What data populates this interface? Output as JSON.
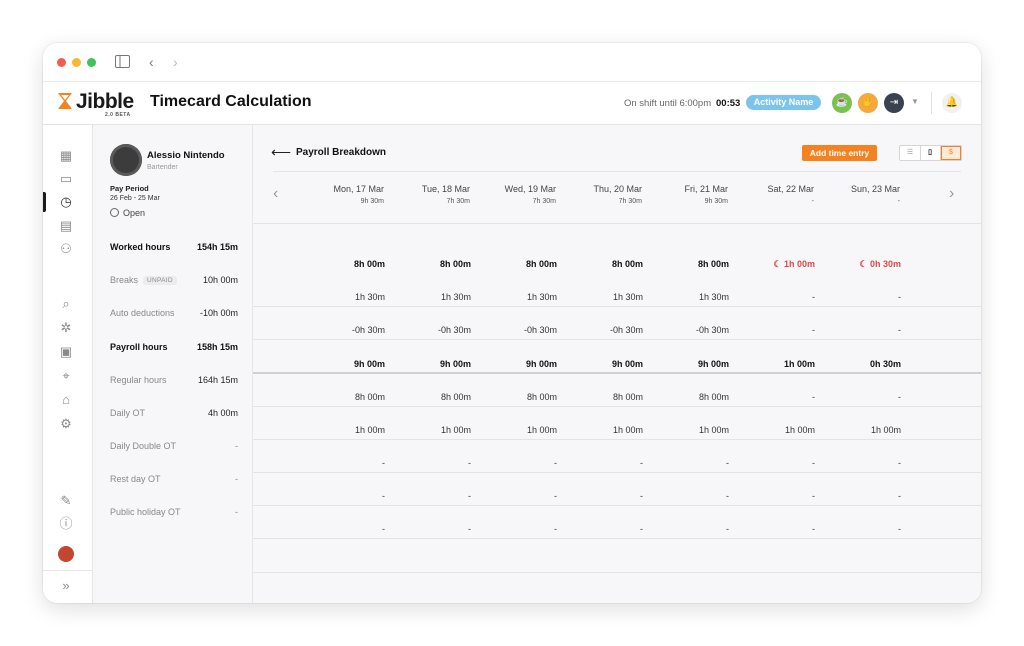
{
  "app": {
    "logo": "Jibble",
    "logo_sub": "2.0 BETA",
    "page_title": "Timecard Calculation"
  },
  "header": {
    "shift_text": "On shift until 6:00pm",
    "timer": "00:53",
    "activity": "Activity Name"
  },
  "employee": {
    "name": "Alessio Nintendo",
    "role": "Bartender",
    "pay_period_label": "Pay Period",
    "pay_period_range": "26 Feb - 25 Mar",
    "status": "Open"
  },
  "breakdown": {
    "title": "Payroll Breakdown",
    "add_button": "Add time entry",
    "days": [
      {
        "name": "Mon, 17 Mar",
        "hours": "9h 30m"
      },
      {
        "name": "Tue, 18 Mar",
        "hours": "7h 30m"
      },
      {
        "name": "Wed, 19 Mar",
        "hours": "7h 30m"
      },
      {
        "name": "Thu, 20 Mar",
        "hours": "7h 30m"
      },
      {
        "name": "Fri, 21 Mar",
        "hours": "9h 30m"
      },
      {
        "name": "Sat, 22 Mar",
        "hours": "-"
      },
      {
        "name": "Sun, 23 Mar",
        "hours": "-"
      }
    ],
    "rows": [
      {
        "label": "Worked hours",
        "total": "154h 15m",
        "cells": [
          "8h 00m",
          "8h 00m",
          "8h 00m",
          "8h 00m",
          "8h 00m",
          "1h 00m",
          "0h 30m"
        ]
      },
      {
        "label": "Breaks",
        "badge": "UNPAID",
        "total": "10h 00m",
        "cells": [
          "1h 30m",
          "1h 30m",
          "1h 30m",
          "1h 30m",
          "1h 30m",
          "-",
          "-"
        ]
      },
      {
        "label": "Auto deductions",
        "total": "-10h 00m",
        "cells": [
          "-0h 30m",
          "-0h 30m",
          "-0h 30m",
          "-0h 30m",
          "-0h 30m",
          "-",
          "-"
        ]
      },
      {
        "label": "Payroll hours",
        "total": "158h 15m",
        "cells": [
          "9h 00m",
          "9h 00m",
          "9h 00m",
          "9h 00m",
          "9h 00m",
          "1h 00m",
          "0h 30m"
        ]
      },
      {
        "label": "Regular hours",
        "total": "164h 15m",
        "cells": [
          "8h 00m",
          "8h 00m",
          "8h 00m",
          "8h 00m",
          "8h 00m",
          "-",
          "-"
        ]
      },
      {
        "label": "Daily OT",
        "total": "4h 00m",
        "cells": [
          "1h 00m",
          "1h 00m",
          "1h 00m",
          "1h 00m",
          "1h 00m",
          "1h 00m",
          "1h 00m"
        ]
      },
      {
        "label": "Daily Double OT",
        "total": "-",
        "cells": [
          "-",
          "-",
          "-",
          "-",
          "-",
          "-",
          "-"
        ]
      },
      {
        "label": "Rest day OT",
        "total": "-",
        "cells": [
          "-",
          "-",
          "-",
          "-",
          "-",
          "-",
          "-"
        ]
      },
      {
        "label": "Public holiday OT",
        "total": "-",
        "cells": [
          "-",
          "-",
          "-",
          "-",
          "-",
          "-",
          "-"
        ]
      }
    ]
  },
  "colors": {
    "accent": "#f58220",
    "activity": "#7bc4ee",
    "alert": "#e04848"
  }
}
